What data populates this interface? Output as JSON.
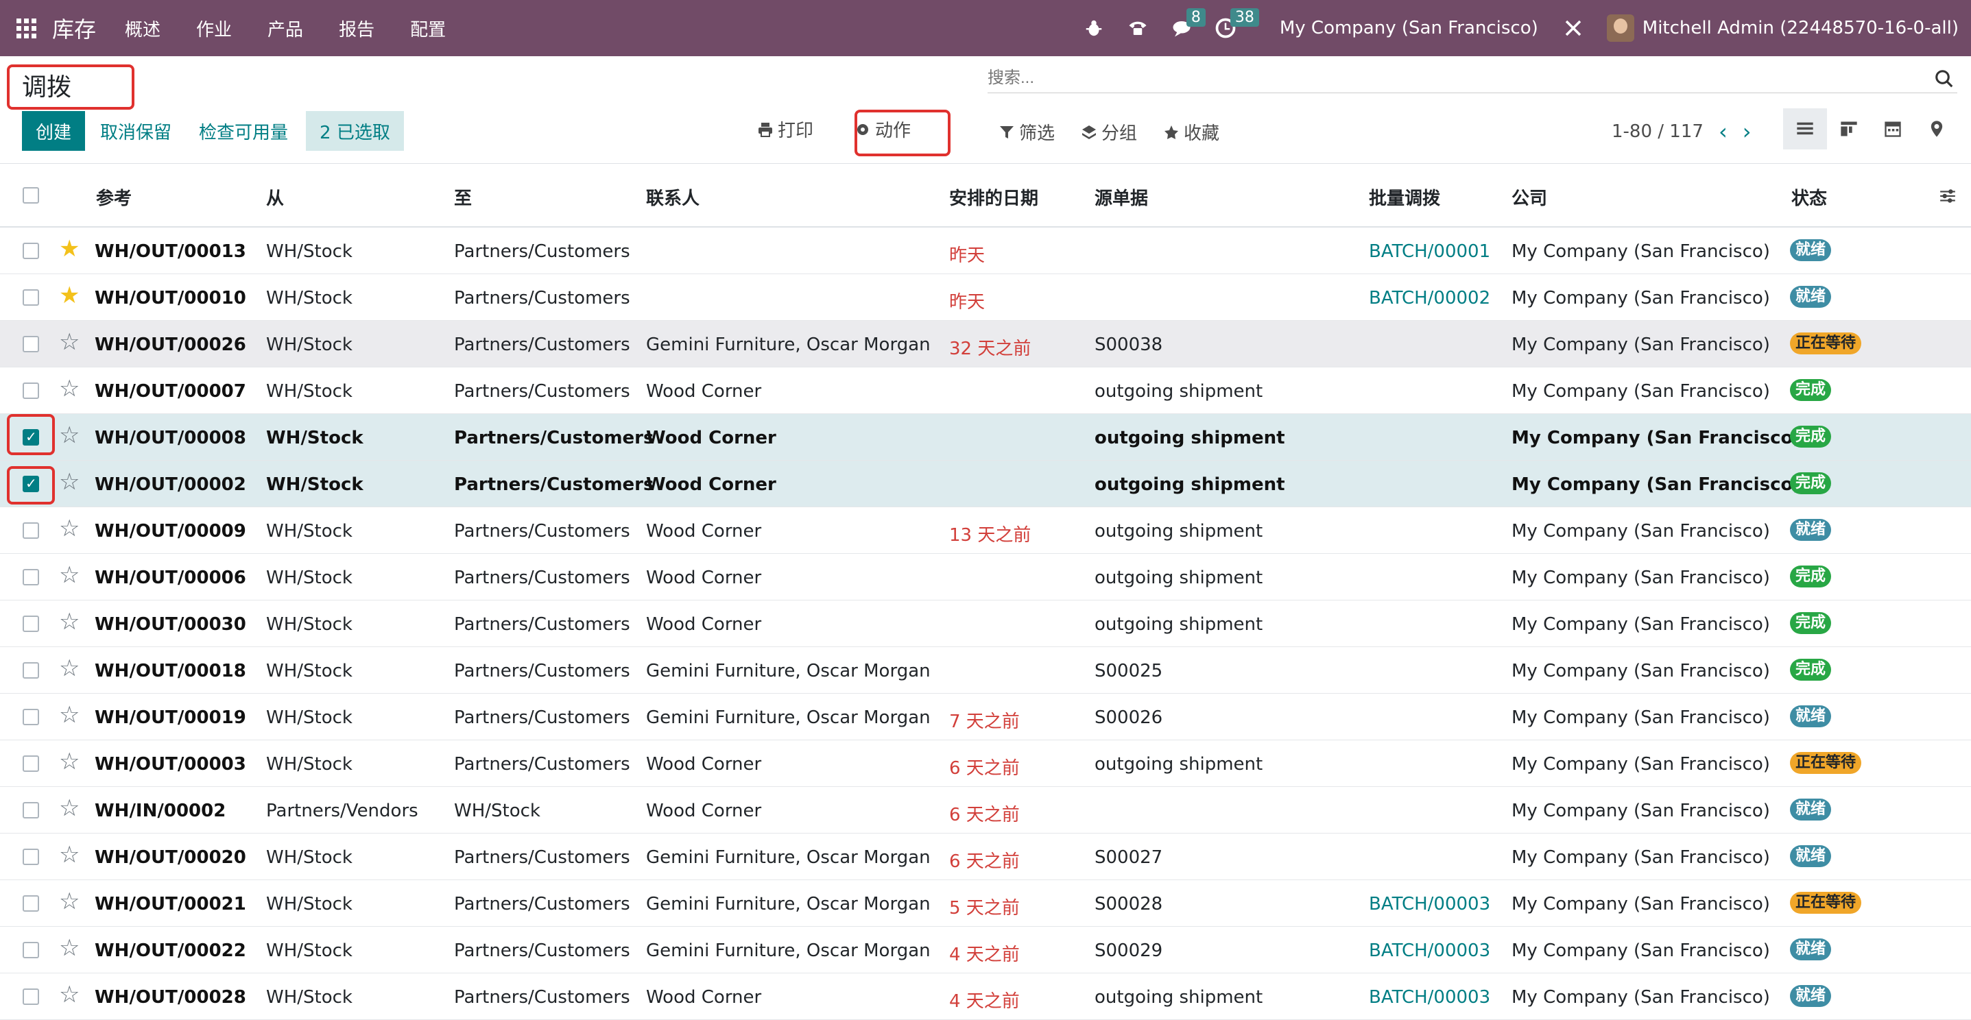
{
  "nav": {
    "app": "库存",
    "menu": [
      "概述",
      "作业",
      "产品",
      "报告",
      "配置"
    ],
    "messages_count": "8",
    "activities_count": "38",
    "company": "My Company (San Francisco)",
    "user": "Mitchell Admin (22448570-16-0-all)"
  },
  "page": {
    "title": "调拨",
    "search_placeholder": "搜索..."
  },
  "toolbar": {
    "create": "创建",
    "unreserve": "取消保留",
    "check_availability": "检查可用量",
    "selected": "2 已选取",
    "print": "打印",
    "action": "动作",
    "filter": "筛选",
    "group": "分组",
    "favorites": "收藏",
    "pager": "1-80 / 117"
  },
  "table": {
    "headers": [
      "参考",
      "从",
      "至",
      "联系人",
      "安排的日期",
      "源单据",
      "批量调拨",
      "公司",
      "状态"
    ],
    "rows": [
      {
        "ref": "WH/OUT/00013",
        "from": "WH/Stock",
        "to": "Partners/Customers",
        "contact": "",
        "date": "昨天",
        "source": "",
        "batch": "BATCH/00001",
        "company": "My Company (San Francisco)",
        "status": "就绪",
        "starred": true,
        "checked": false
      },
      {
        "ref": "WH/OUT/00010",
        "from": "WH/Stock",
        "to": "Partners/Customers",
        "contact": "",
        "date": "昨天",
        "source": "",
        "batch": "BATCH/00002",
        "company": "My Company (San Francisco)",
        "status": "就绪",
        "starred": true,
        "checked": false
      },
      {
        "ref": "WH/OUT/00026",
        "from": "WH/Stock",
        "to": "Partners/Customers",
        "contact": "Gemini Furniture, Oscar Morgan",
        "date": "32 天之前",
        "source": "S00038",
        "batch": "",
        "company": "My Company (San Francisco)",
        "status": "正在等待",
        "starred": false,
        "checked": false
      },
      {
        "ref": "WH/OUT/00007",
        "from": "WH/Stock",
        "to": "Partners/Customers",
        "contact": "Wood Corner",
        "date": "",
        "source": "outgoing shipment",
        "batch": "",
        "company": "My Company (San Francisco)",
        "status": "完成",
        "starred": false,
        "checked": false
      },
      {
        "ref": "WH/OUT/00008",
        "from": "WH/Stock",
        "to": "Partners/Customers",
        "contact": "Wood Corner",
        "date": "",
        "source": "outgoing shipment",
        "batch": "",
        "company": "My Company (San Francisco)",
        "status": "完成",
        "starred": false,
        "checked": true
      },
      {
        "ref": "WH/OUT/00002",
        "from": "WH/Stock",
        "to": "Partners/Customers",
        "contact": "Wood Corner",
        "date": "",
        "source": "outgoing shipment",
        "batch": "",
        "company": "My Company (San Francisco)",
        "status": "完成",
        "starred": false,
        "checked": true
      },
      {
        "ref": "WH/OUT/00009",
        "from": "WH/Stock",
        "to": "Partners/Customers",
        "contact": "Wood Corner",
        "date": "13 天之前",
        "source": "outgoing shipment",
        "batch": "",
        "company": "My Company (San Francisco)",
        "status": "就绪",
        "starred": false,
        "checked": false
      },
      {
        "ref": "WH/OUT/00006",
        "from": "WH/Stock",
        "to": "Partners/Customers",
        "contact": "Wood Corner",
        "date": "",
        "source": "outgoing shipment",
        "batch": "",
        "company": "My Company (San Francisco)",
        "status": "完成",
        "starred": false,
        "checked": false
      },
      {
        "ref": "WH/OUT/00030",
        "from": "WH/Stock",
        "to": "Partners/Customers",
        "contact": "Wood Corner",
        "date": "",
        "source": "outgoing shipment",
        "batch": "",
        "company": "My Company (San Francisco)",
        "status": "完成",
        "starred": false,
        "checked": false
      },
      {
        "ref": "WH/OUT/00018",
        "from": "WH/Stock",
        "to": "Partners/Customers",
        "contact": "Gemini Furniture, Oscar Morgan",
        "date": "",
        "source": "S00025",
        "batch": "",
        "company": "My Company (San Francisco)",
        "status": "完成",
        "starred": false,
        "checked": false
      },
      {
        "ref": "WH/OUT/00019",
        "from": "WH/Stock",
        "to": "Partners/Customers",
        "contact": "Gemini Furniture, Oscar Morgan",
        "date": "7 天之前",
        "source": "S00026",
        "batch": "",
        "company": "My Company (San Francisco)",
        "status": "就绪",
        "starred": false,
        "checked": false
      },
      {
        "ref": "WH/OUT/00003",
        "from": "WH/Stock",
        "to": "Partners/Customers",
        "contact": "Wood Corner",
        "date": "6 天之前",
        "source": "outgoing shipment",
        "batch": "",
        "company": "My Company (San Francisco)",
        "status": "正在等待",
        "starred": false,
        "checked": false
      },
      {
        "ref": "WH/IN/00002",
        "from": "Partners/Vendors",
        "to": "WH/Stock",
        "contact": "Wood Corner",
        "date": "6 天之前",
        "source": "",
        "batch": "",
        "company": "My Company (San Francisco)",
        "status": "就绪",
        "starred": false,
        "checked": false
      },
      {
        "ref": "WH/OUT/00020",
        "from": "WH/Stock",
        "to": "Partners/Customers",
        "contact": "Gemini Furniture, Oscar Morgan",
        "date": "6 天之前",
        "source": "S00027",
        "batch": "",
        "company": "My Company (San Francisco)",
        "status": "就绪",
        "starred": false,
        "checked": false
      },
      {
        "ref": "WH/OUT/00021",
        "from": "WH/Stock",
        "to": "Partners/Customers",
        "contact": "Gemini Furniture, Oscar Morgan",
        "date": "5 天之前",
        "source": "S00028",
        "batch": "BATCH/00003",
        "company": "My Company (San Francisco)",
        "status": "正在等待",
        "starred": false,
        "checked": false
      },
      {
        "ref": "WH/OUT/00022",
        "from": "WH/Stock",
        "to": "Partners/Customers",
        "contact": "Gemini Furniture, Oscar Morgan",
        "date": "4 天之前",
        "source": "S00029",
        "batch": "BATCH/00003",
        "company": "My Company (San Francisco)",
        "status": "就绪",
        "starred": false,
        "checked": false
      },
      {
        "ref": "WH/OUT/00028",
        "from": "WH/Stock",
        "to": "Partners/Customers",
        "contact": "Wood Corner",
        "date": "4 天之前",
        "source": "outgoing shipment",
        "batch": "BATCH/00003",
        "company": "My Company (San Francisco)",
        "status": "就绪",
        "starred": false,
        "checked": false
      }
    ]
  },
  "colors": {
    "navbar": "#714B67",
    "primary": "#017E84",
    "overdue": "#D23F3A",
    "highlight": "#E0312E"
  },
  "icons": [
    "apps-grid-icon",
    "bug-icon",
    "phone-icon",
    "chat-icon",
    "clock-icon",
    "tools-icon",
    "search-icon",
    "print-icon",
    "gear-icon",
    "filter-icon",
    "layers-icon",
    "star-icon",
    "list-view-icon",
    "kanban-view-icon",
    "calendar-view-icon",
    "map-view-icon",
    "column-settings-icon"
  ]
}
